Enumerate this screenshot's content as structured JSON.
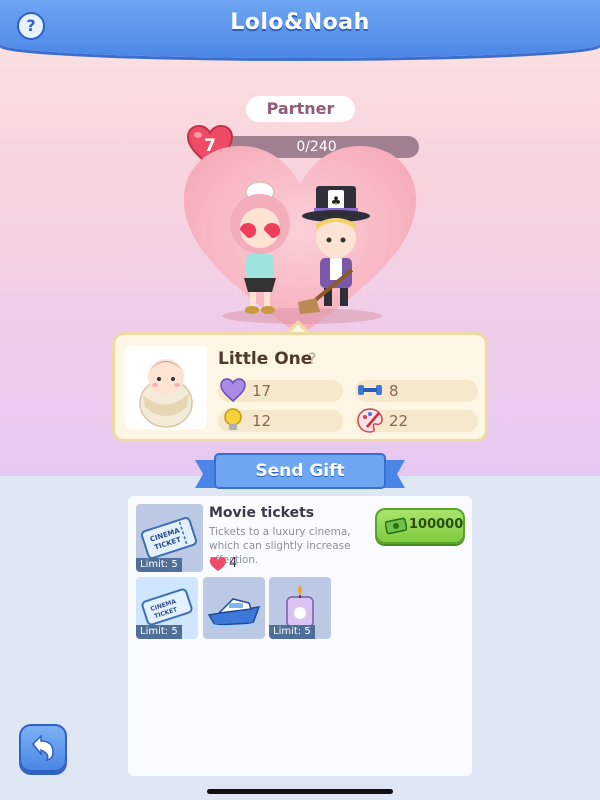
{
  "header": {
    "title": "Lolo&Noah",
    "help_label": "?"
  },
  "relationship": {
    "partner_label": "Partner",
    "level": "7",
    "progress_text": "0/240",
    "progress_fraction": 0
  },
  "baby_card": {
    "name": "Little One",
    "help_label": "?",
    "stats": [
      {
        "icon": "heart-icon",
        "value": "17"
      },
      {
        "icon": "dumbbell-icon",
        "value": "8"
      },
      {
        "icon": "lightbulb-icon",
        "value": "12"
      },
      {
        "icon": "palette-icon",
        "value": "22"
      }
    ]
  },
  "send_gift": {
    "label": "Send Gift"
  },
  "gift_detail": {
    "title": "Movie tickets",
    "description": "Tickets to a luxury cinema, which can slightly increase affection.",
    "affection": "4",
    "price": "100000",
    "limit": "Limit: 5"
  },
  "gift_list": [
    {
      "name": "movie-ticket",
      "limit": "Limit: 5",
      "selected": true
    },
    {
      "name": "yacht",
      "limit": "",
      "selected": false
    },
    {
      "name": "candle",
      "limit": "Limit: 5",
      "selected": false
    }
  ],
  "colors": {
    "header": "#4b86e6",
    "accent_pink": "#f26b82",
    "buy_green": "#7fcc3e"
  }
}
